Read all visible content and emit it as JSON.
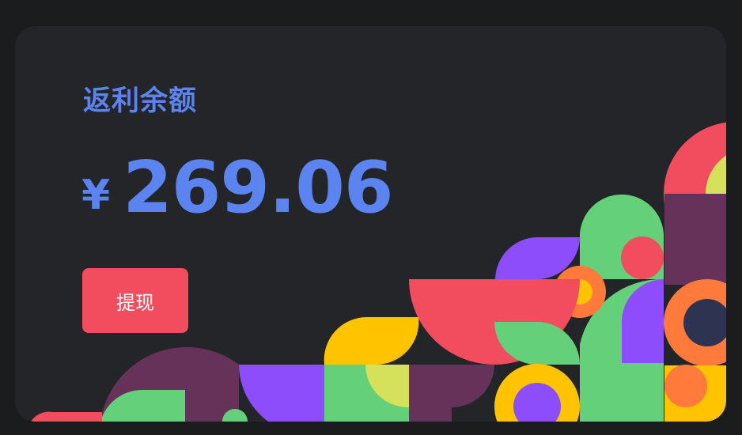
{
  "rebate_card": {
    "title": "返利余额",
    "currency_symbol": "¥",
    "amount": "269.06",
    "withdraw_label": "提现"
  },
  "colors": {
    "page_bg": "#1b1c1e",
    "card_bg": "#242528",
    "accent_blue": "#5b84f0",
    "button_red": "#f24d5e"
  }
}
